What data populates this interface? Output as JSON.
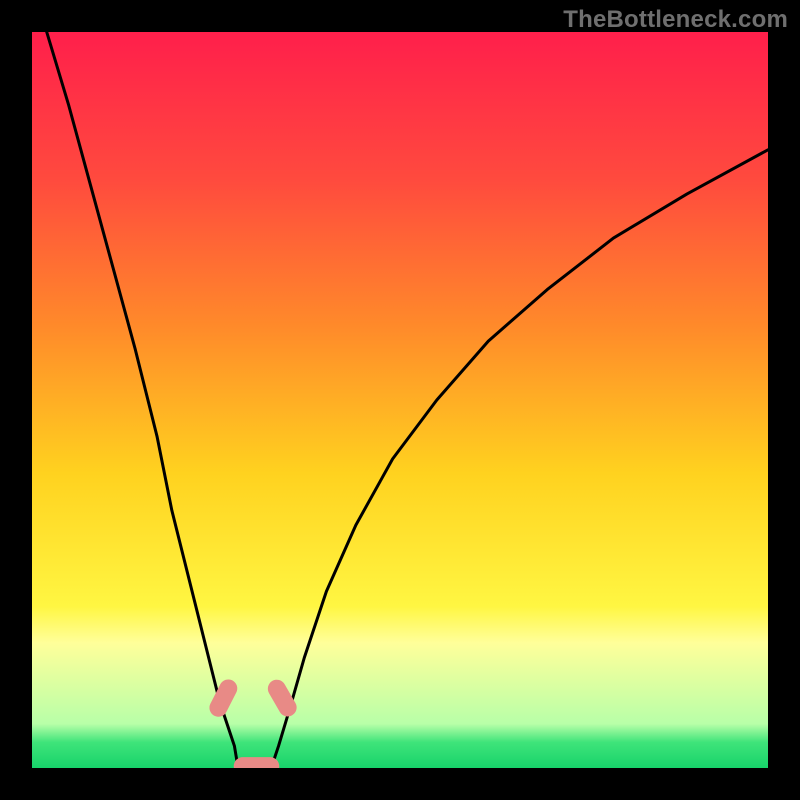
{
  "watermark": "TheBottleneck.com",
  "chart_data": {
    "type": "line",
    "title": "",
    "xlabel": "",
    "ylabel": "",
    "xlim": [
      0,
      100
    ],
    "ylim": [
      0,
      100
    ],
    "grid": false,
    "legend": false,
    "background_gradient": [
      {
        "stop": 0.0,
        "color": "#ff1f4b"
      },
      {
        "stop": 0.2,
        "color": "#ff4a3e"
      },
      {
        "stop": 0.4,
        "color": "#ff8a2a"
      },
      {
        "stop": 0.6,
        "color": "#ffd21f"
      },
      {
        "stop": 0.78,
        "color": "#fff642"
      },
      {
        "stop": 0.83,
        "color": "#ffff9a"
      },
      {
        "stop": 0.94,
        "color": "#b8ffa8"
      },
      {
        "stop": 0.965,
        "color": "#3fe47a"
      },
      {
        "stop": 1.0,
        "color": "#17d36a"
      }
    ],
    "series": [
      {
        "name": "left-curve",
        "x": [
          2,
          5,
          8,
          11,
          14,
          17,
          19,
          21,
          23,
          24.5,
          25.5,
          26.5,
          27.5,
          28.0
        ],
        "y": [
          100,
          90,
          79,
          68,
          57,
          45,
          35,
          27,
          19,
          13,
          9,
          6,
          3,
          0
        ]
      },
      {
        "name": "right-curve",
        "x": [
          32.5,
          33.5,
          35,
          37,
          40,
          44,
          49,
          55,
          62,
          70,
          79,
          89,
          100
        ],
        "y": [
          0,
          3,
          8,
          15,
          24,
          33,
          42,
          50,
          58,
          65,
          72,
          78,
          84
        ]
      }
    ],
    "markers": [
      {
        "name": "marker-left-upper",
        "x_range": [
          25.0,
          27.0
        ],
        "y_range": [
          7.0,
          12.0
        ],
        "angle_deg": -63
      },
      {
        "name": "marker-right-upper",
        "x_range": [
          33.0,
          35.0
        ],
        "y_range": [
          7.0,
          12.0
        ],
        "angle_deg": 60
      },
      {
        "name": "marker-bottom",
        "x_range": [
          27.5,
          33.5
        ],
        "y_range": [
          -0.5,
          1.0
        ],
        "angle_deg": 0
      }
    ]
  }
}
